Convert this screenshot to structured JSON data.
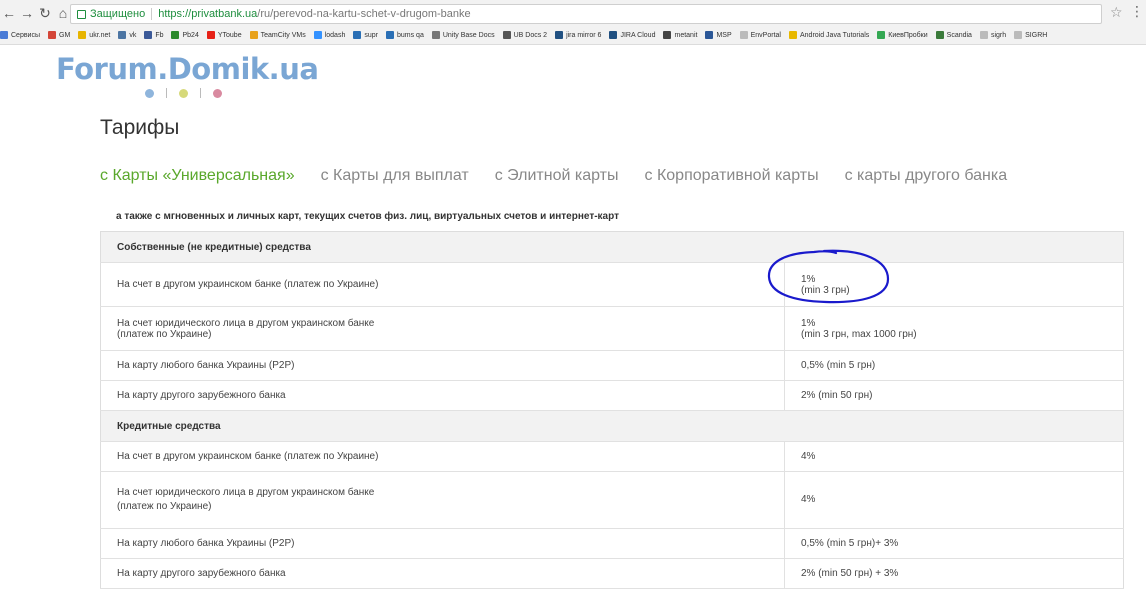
{
  "browser": {
    "secure_label": "Защищено",
    "url_host": "https://privatbank.ua",
    "url_path": "/ru/perevod-na-kartu-schet-v-drugom-banke"
  },
  "bookmarks": [
    "Сервисы",
    "GM",
    "ukr.net",
    "vk",
    "Fb",
    "Pb24",
    "YToube",
    "TeamCity VMs",
    "lodash",
    "supr",
    "bums qa",
    "Unity Base Docs",
    "UB Docs 2",
    "jira mirror 6",
    "JIRA Cloud",
    "metanit",
    "MSP",
    "EnvPortal",
    "Android Java Tutorials",
    "КиевПробки",
    "Scandia",
    "sigrh",
    "SIGRH"
  ],
  "logo": {
    "text": "Forum.Domik.ua",
    "color": "#7aa6d4",
    "dot_colors": [
      "#8fb5dc",
      "#d6d97a",
      "#d98aa0"
    ]
  },
  "page_title": "Тарифы",
  "tabs": [
    {
      "label": "с Карты «Универсальная»",
      "active": true
    },
    {
      "label": "с Карты для выплат",
      "active": false
    },
    {
      "label": "с Элитной карты",
      "active": false
    },
    {
      "label": "с Корпоративной карты",
      "active": false
    },
    {
      "label": "с карты другого банка",
      "active": false
    }
  ],
  "note": "а также с мгновенных и личных карт, текущих счетов физ. лиц, виртуальных счетов и интернет-карт",
  "sections": [
    {
      "title": "Собственные (не кредитные) средства",
      "rows": [
        {
          "label": "На счет в другом украинском банке (платеж по Украине)",
          "value_line1": "1%",
          "value_line2": "(min 3 грн)"
        },
        {
          "label_line1": "На счет юридического лица в другом украинском банке",
          "label_line2": "(платеж по Украине)",
          "value_line1": "1%",
          "value_line2": "(min 3 грн, max 1000 грн)"
        },
        {
          "label": "На карту любого банка Украины (P2P)",
          "value": "0,5% (min 5 грн)"
        },
        {
          "label": "На карту другого зарубежного банка",
          "value": "2% (min 50 грн)"
        }
      ]
    },
    {
      "title": "Кредитные средства",
      "rows": [
        {
          "label": "На счет в другом украинском банке (платеж по Украине)",
          "value": "4%"
        },
        {
          "label_line1": "На счет юридического лица в другом украинском банке",
          "label_line2": "(платеж по Украине)",
          "value": "4%"
        },
        {
          "label": "На карту любого банка Украины (P2P)",
          "value": "0,5% (min 5 грн)+ 3%"
        },
        {
          "label": "На карту другого зарубежного банка",
          "value": "2% (min 50 грн) + 3%"
        }
      ]
    }
  ],
  "colors": {
    "active_tab": "#5aa82c",
    "annotation": "#1a1acc"
  }
}
